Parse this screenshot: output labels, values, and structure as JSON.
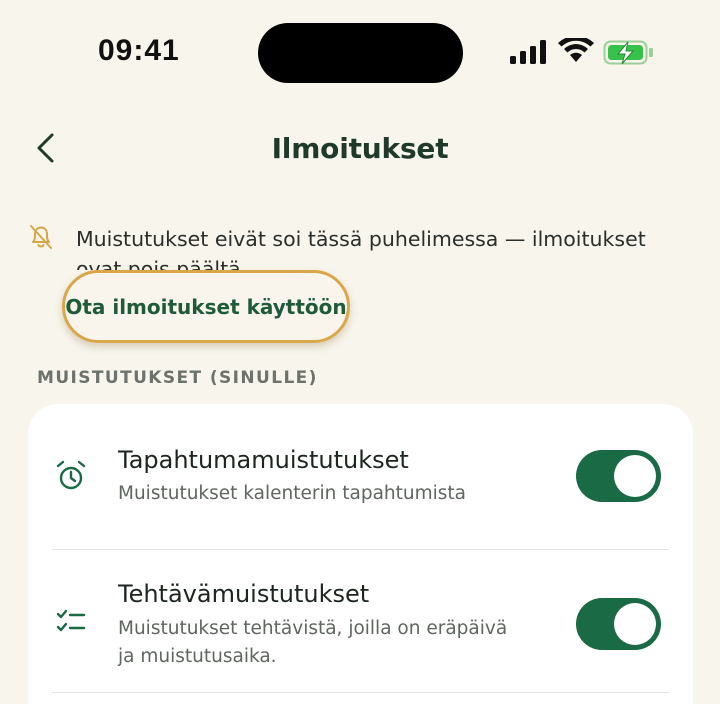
{
  "status_bar": {
    "time": "09:41"
  },
  "header": {
    "title": "Ilmoitukset",
    "back_icon": "chevron-left-icon"
  },
  "banner": {
    "icon": "bell-off-icon",
    "message": "Muistutukset eivät soi tässä puhelimessa — ilmoitukset ovat pois päältä.",
    "action_label": "Ota ilmoitukset käyttöön"
  },
  "section": {
    "label": "MUISTUTUKSET (SINULLE)"
  },
  "settings": [
    {
      "icon": "alarm-clock-icon",
      "title": "Tapahtumamuistutukset",
      "subtitle": "Muistutukset kalenterin tapahtumista",
      "enabled": true
    },
    {
      "icon": "checklist-icon",
      "title": "Tehtävämuistutukset",
      "subtitle_line1": "Muistutukset tehtävistä, joilla on eräpäivä",
      "subtitle_line2": "ja muistutusaika.",
      "enabled": true
    }
  ],
  "colors": {
    "background": "#f8f5ec",
    "accent_green": "#1a6a45",
    "highlight_ring": "#d9a64a",
    "warning_icon": "#d9a64a"
  }
}
